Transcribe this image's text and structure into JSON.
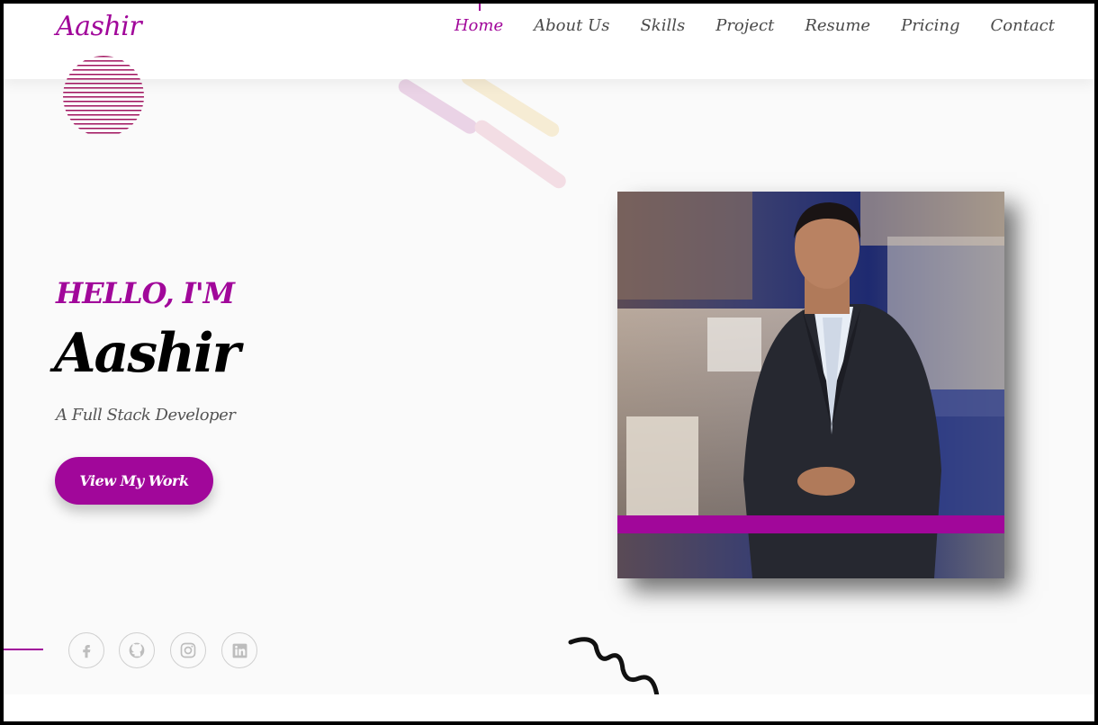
{
  "header": {
    "brand": "Aashir",
    "nav_items": [
      {
        "label": "Home",
        "active": true
      },
      {
        "label": "About Us",
        "active": false
      },
      {
        "label": "Skills",
        "active": false
      },
      {
        "label": "Project",
        "active": false
      },
      {
        "label": "Resume",
        "active": false
      },
      {
        "label": "Pricing",
        "active": false
      },
      {
        "label": "Contact",
        "active": false
      }
    ]
  },
  "hero": {
    "greeting": "HELLO, I'M",
    "name": "Aashir",
    "tagline": "A Full Stack Developer",
    "cta_label": "View My Work"
  },
  "social": [
    {
      "icon": "facebook-icon"
    },
    {
      "icon": "github-icon"
    },
    {
      "icon": "instagram-icon"
    },
    {
      "icon": "linkedin-icon"
    }
  ],
  "colors": {
    "accent": "#a1079a",
    "background": "#fafafa",
    "nav_text": "#4a4a4a"
  }
}
